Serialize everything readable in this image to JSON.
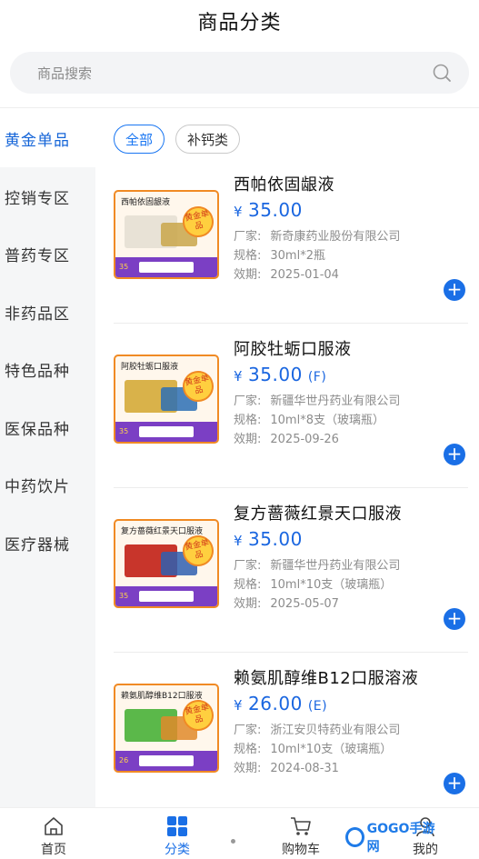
{
  "header": {
    "title": "商品分类"
  },
  "search": {
    "placeholder": "商品搜索"
  },
  "sidebar": {
    "items": [
      {
        "label": "黄金单品",
        "active": true
      },
      {
        "label": "控销专区",
        "active": false
      },
      {
        "label": "普药专区",
        "active": false
      },
      {
        "label": "非药品区",
        "active": false
      },
      {
        "label": "特色品种",
        "active": false
      },
      {
        "label": "医保品种",
        "active": false
      },
      {
        "label": "中药饮片",
        "active": false
      },
      {
        "label": "医疗器械",
        "active": false
      }
    ]
  },
  "filters": [
    {
      "label": "全部",
      "active": true
    },
    {
      "label": "补钙类",
      "active": false
    }
  ],
  "products": [
    {
      "name": "西帕依固龈液",
      "currency": "¥",
      "price": "35.00",
      "grade": "",
      "meta_labels": {
        "maker": "厂家:",
        "spec": "规格:",
        "expiry": "效期:"
      },
      "maker": "新奇康药业股份有限公司",
      "spec": "30ml*2瓶",
      "expiry": "2025-01-04",
      "thumb_title": "西帕依固龈液",
      "seal": "黄金单品",
      "thumb_price": "35",
      "box_color": "#e8e2d6",
      "box2_color": "#c9a64a"
    },
    {
      "name": "阿胶牡蛎口服液",
      "currency": "¥",
      "price": "35.00",
      "grade": "(F)",
      "meta_labels": {
        "maker": "厂家:",
        "spec": "规格:",
        "expiry": "效期:"
      },
      "maker": "新疆华世丹药业有限公司",
      "spec": "10ml*8支（玻璃瓶）",
      "expiry": "2025-09-26",
      "thumb_title": "阿胶牡蛎口服液",
      "seal": "黄金单品",
      "thumb_price": "35",
      "box_color": "#d9b24a",
      "box2_color": "#2c6fb5"
    },
    {
      "name": "复方蔷薇红景天口服液",
      "currency": "¥",
      "price": "35.00",
      "grade": "",
      "meta_labels": {
        "maker": "厂家:",
        "spec": "规格:",
        "expiry": "效期:"
      },
      "maker": "新疆华世丹药业有限公司",
      "spec": "10ml*10支（玻璃瓶）",
      "expiry": "2025-05-07",
      "thumb_title": "复方蔷薇红景天口服液",
      "seal": "黄金单品",
      "thumb_price": "35",
      "box_color": "#c8352b",
      "box2_color": "#2f5fb0"
    },
    {
      "name": "赖氨肌醇维B12口服溶液",
      "currency": "¥",
      "price": "26.00",
      "grade": "(E)",
      "meta_labels": {
        "maker": "厂家:",
        "spec": "规格:",
        "expiry": "效期:"
      },
      "maker": "浙江安贝特药业有限公司",
      "spec": "10ml*10支（玻璃瓶）",
      "expiry": "2024-08-31",
      "thumb_title": "赖氨肌醇维B12口服液",
      "seal": "黄金单品",
      "thumb_price": "26",
      "box_color": "#5bb84a",
      "box2_color": "#e08a2a"
    }
  ],
  "tabbar": {
    "items": [
      {
        "label": "首页",
        "icon": "home-icon",
        "active": false
      },
      {
        "label": "分类",
        "icon": "grid-icon",
        "active": true
      },
      {
        "label": "购物车",
        "icon": "cart-icon",
        "active": false
      },
      {
        "label": "我的",
        "icon": "user-icon",
        "active": false
      }
    ]
  },
  "watermark": {
    "text": "GOGO手游网"
  },
  "colors": {
    "accent": "#1a6fe6",
    "sidebar_bg": "#f5f6f7",
    "thumb_border": "#f08a24"
  }
}
